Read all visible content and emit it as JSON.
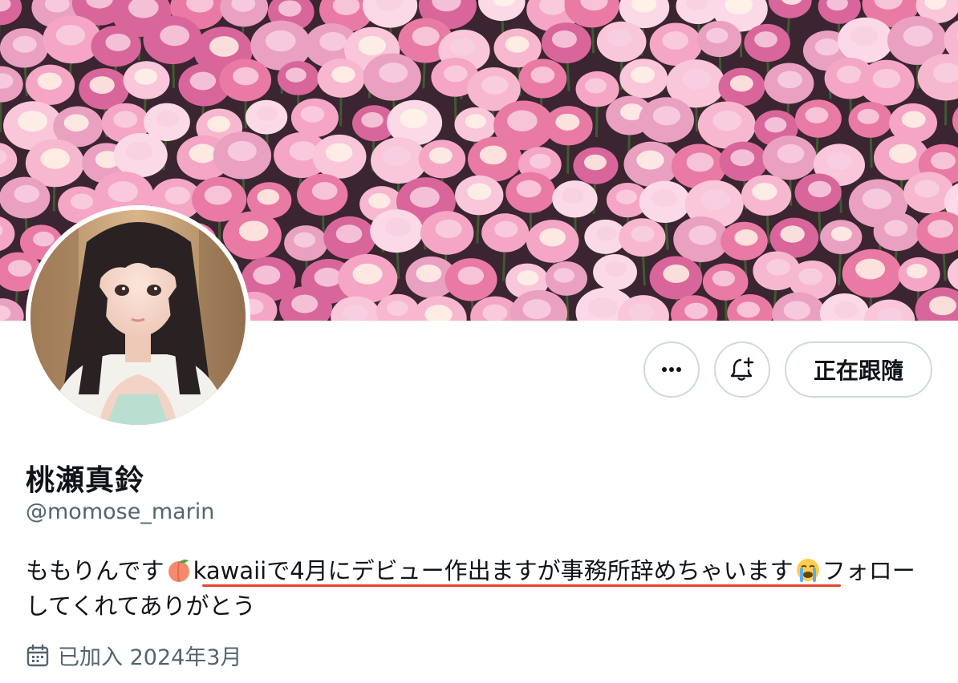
{
  "profile": {
    "display_name": "桃瀬真鈴",
    "handle": "@momose_marin",
    "bio_part1": "ももりんです",
    "bio_part2": "kawaiiで4月にデビュー作出ますが事務所辞めちゃいます",
    "bio_part3": "フォローしてくれてありがとう",
    "joined_label": "已加入 2024年3月"
  },
  "actions": {
    "more_label": "•••",
    "follow_label": "正在跟隨"
  },
  "icons": {
    "more": "more-horizontal-icon",
    "notify": "bell-plus-icon",
    "calendar": "calendar-icon",
    "peach": "peach-emoji",
    "crying": "loudly-crying-emoji"
  },
  "colors": {
    "text_primary": "#0f1419",
    "text_secondary": "#536471",
    "border": "#cfd9de",
    "annotation_underline": "#e0452c"
  }
}
